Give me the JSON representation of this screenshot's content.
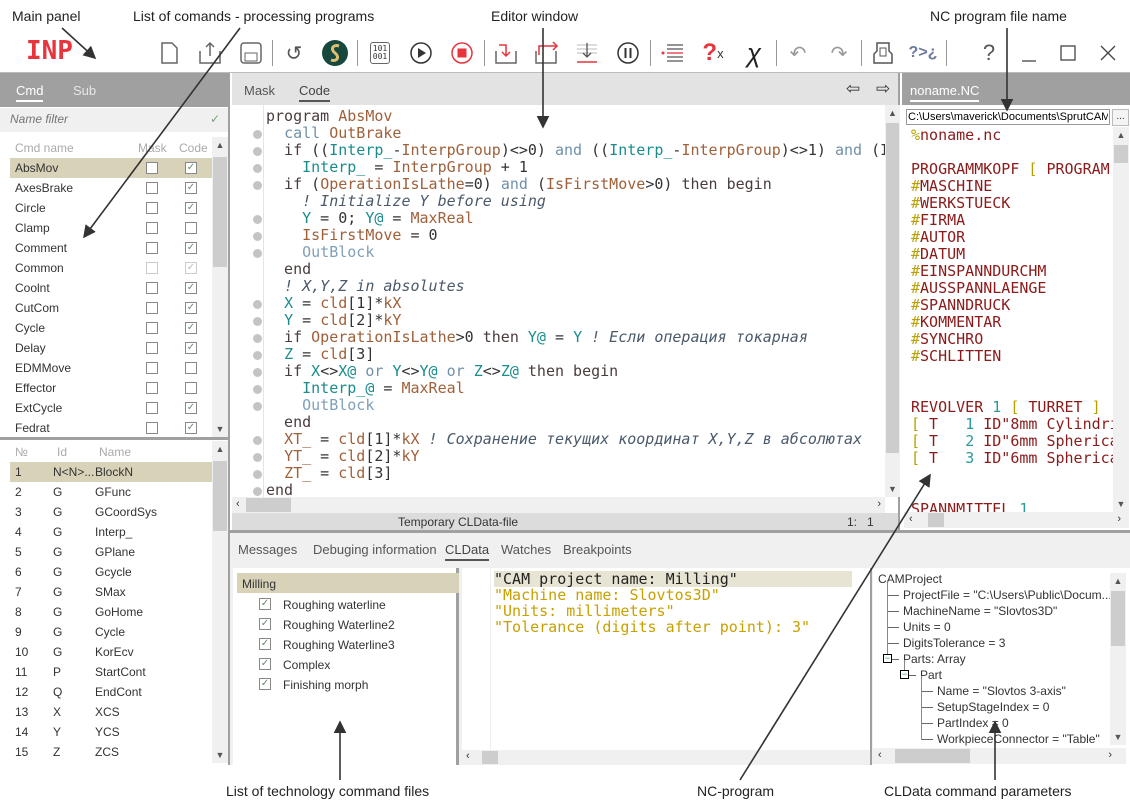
{
  "annotations": {
    "top": [
      "Main panel",
      "List of comands - processing programs",
      "Editor window",
      "NC program file name"
    ],
    "bottom": [
      "List of technology command files",
      "NC-program",
      "CLData command parameters"
    ]
  },
  "toolbar": {
    "logo": "INP",
    "binary_icon_text": "101\n001",
    "icons": [
      "new-file-icon",
      "export-icon",
      "save-icon",
      "reload-icon",
      "sprutcam-logo-icon",
      "compile-binary-icon",
      "run-icon",
      "stop-icon",
      "step-into-icon",
      "step-over-icon",
      "step-out-icon",
      "pause-icon",
      "breakpoint-list-icon",
      "clear-watch-icon",
      "cross-icon",
      "undo-icon",
      "redo-icon",
      "machine-icon",
      "translate-icon",
      "help-icon",
      "minimize-icon",
      "maximize-icon",
      "close-icon"
    ],
    "help_label": "?",
    "translate_label": "?>¿",
    "colors": {
      "logo": "#e8343c",
      "stop": "#e8343c"
    }
  },
  "left_panel": {
    "tabs": [
      "Cmd",
      "Sub"
    ],
    "active_tab": "Cmd",
    "filter_placeholder": "Name filter",
    "columns": [
      "Cmd name",
      "Mask",
      "Code"
    ],
    "commands": [
      {
        "name": "AbsMov",
        "mask": false,
        "code": true,
        "selected": true
      },
      {
        "name": "AxesBrake",
        "mask": false,
        "code": true
      },
      {
        "name": "Circle",
        "mask": false,
        "code": true
      },
      {
        "name": "Clamp",
        "mask": false,
        "code": false
      },
      {
        "name": "Comment",
        "mask": false,
        "code": true
      },
      {
        "name": "Common",
        "mask": false,
        "code": true,
        "disabled": true
      },
      {
        "name": "Coolnt",
        "mask": false,
        "code": true
      },
      {
        "name": "CutCom",
        "mask": false,
        "code": true
      },
      {
        "name": "Cycle",
        "mask": false,
        "code": true
      },
      {
        "name": "Delay",
        "mask": false,
        "code": true
      },
      {
        "name": "EDMMove",
        "mask": false,
        "code": false
      },
      {
        "name": "Effector",
        "mask": false,
        "code": false
      },
      {
        "name": "ExtCycle",
        "mask": false,
        "code": true
      },
      {
        "name": "Fedrat",
        "mask": false,
        "code": true
      }
    ],
    "reg_columns": [
      "№",
      "Id",
      "Name"
    ],
    "registers": [
      [
        "1",
        "N<N>...",
        "BlockN"
      ],
      [
        "2",
        "G",
        "GFunc"
      ],
      [
        "3",
        "G",
        "GCoordSys"
      ],
      [
        "4",
        "G",
        "Interp_"
      ],
      [
        "5",
        "G",
        "GPlane"
      ],
      [
        "6",
        "G",
        "Gcycle"
      ],
      [
        "7",
        "G",
        "SMax"
      ],
      [
        "8",
        "G",
        "GoHome"
      ],
      [
        "9",
        "G",
        "Cycle"
      ],
      [
        "10",
        "G",
        "KorEcv"
      ],
      [
        "11",
        "P",
        "StartCont"
      ],
      [
        "12",
        "Q",
        "EndCont"
      ],
      [
        "13",
        "X",
        "XCS"
      ],
      [
        "14",
        "Y",
        "YCS"
      ],
      [
        "15",
        "Z",
        "ZCS"
      ]
    ]
  },
  "editor": {
    "tabs": [
      "Mask",
      "Code"
    ],
    "active_tab": "Code",
    "status_label": "Temporary CLData-file",
    "cursor_pos": "1:   1",
    "lines": [
      {
        "dot": false,
        "tokens": [
          [
            "program ",
            "k"
          ],
          [
            "AbsMov",
            "f"
          ]
        ]
      },
      {
        "dot": true,
        "tokens": [
          [
            "  ",
            " p"
          ],
          [
            "call ",
            "l"
          ],
          [
            "OutBrake",
            "f"
          ]
        ]
      },
      {
        "dot": true,
        "tokens": [
          [
            "  if ",
            "k"
          ],
          [
            "((",
            "p"
          ],
          [
            "Interp_",
            "v"
          ],
          [
            "-",
            "p"
          ],
          [
            "InterpGroup",
            "f"
          ],
          [
            ")<>0) ",
            "p"
          ],
          [
            "and ",
            "l"
          ],
          [
            "((",
            "p"
          ],
          [
            "Interp_",
            "v"
          ],
          [
            "-",
            "p"
          ],
          [
            "InterpGroup",
            "f"
          ],
          [
            ")<>1) ",
            "p"
          ],
          [
            "and ",
            "l"
          ],
          [
            "(I",
            "p"
          ]
        ]
      },
      {
        "dot": true,
        "tokens": [
          [
            "    ",
            "p"
          ],
          [
            "Interp_",
            "v"
          ],
          [
            " = ",
            "p"
          ],
          [
            "InterpGroup",
            "f"
          ],
          [
            " + 1",
            "p"
          ]
        ]
      },
      {
        "dot": true,
        "tokens": [
          [
            "  if ",
            "k"
          ],
          [
            "(",
            "p"
          ],
          [
            "OperationIsLathe",
            "f"
          ],
          [
            "=0) ",
            "p"
          ],
          [
            "and ",
            "l"
          ],
          [
            "(",
            "p"
          ],
          [
            "IsFirstMove",
            "f"
          ],
          [
            ">0) ",
            "p"
          ],
          [
            "then begin",
            "k"
          ]
        ]
      },
      {
        "dot": false,
        "tokens": [
          [
            "    ! Initialize Y before using",
            "c"
          ]
        ]
      },
      {
        "dot": true,
        "tokens": [
          [
            "    ",
            "p"
          ],
          [
            "Y",
            "v"
          ],
          [
            " = 0; ",
            "p"
          ],
          [
            "Y@",
            "v"
          ],
          [
            " = ",
            "p"
          ],
          [
            "MaxReal",
            "f"
          ]
        ]
      },
      {
        "dot": true,
        "tokens": [
          [
            "    ",
            "p"
          ],
          [
            "IsFirstMove",
            "f"
          ],
          [
            " = 0",
            "p"
          ]
        ]
      },
      {
        "dot": true,
        "tokens": [
          [
            "    ",
            "p"
          ],
          [
            "OutBlock",
            "o"
          ]
        ]
      },
      {
        "dot": false,
        "tokens": [
          [
            "  end",
            "k"
          ]
        ]
      },
      {
        "dot": false,
        "tokens": [
          [
            "  ! X,Y,Z in absolutes",
            "c"
          ]
        ]
      },
      {
        "dot": true,
        "tokens": [
          [
            "  ",
            "p"
          ],
          [
            "X",
            "v"
          ],
          [
            " = ",
            "p"
          ],
          [
            "cld",
            "f"
          ],
          [
            "[1]*",
            "p"
          ],
          [
            "kX",
            "f"
          ]
        ]
      },
      {
        "dot": true,
        "tokens": [
          [
            "  ",
            "p"
          ],
          [
            "Y",
            "v"
          ],
          [
            " = ",
            "p"
          ],
          [
            "cld",
            "f"
          ],
          [
            "[2]*",
            "p"
          ],
          [
            "kY",
            "f"
          ]
        ]
      },
      {
        "dot": true,
        "tokens": [
          [
            "  if ",
            "k"
          ],
          [
            "OperationIsLathe",
            "f"
          ],
          [
            ">0 ",
            "p"
          ],
          [
            "then ",
            "k"
          ],
          [
            "Y@",
            "v"
          ],
          [
            " = ",
            "p"
          ],
          [
            "Y",
            "v"
          ],
          [
            " ! Если операция токарная",
            "c"
          ]
        ]
      },
      {
        "dot": true,
        "tokens": [
          [
            "  ",
            "p"
          ],
          [
            "Z",
            "v"
          ],
          [
            " = ",
            "p"
          ],
          [
            "cld",
            "f"
          ],
          [
            "[3]",
            "p"
          ]
        ]
      },
      {
        "dot": true,
        "tokens": [
          [
            "  if ",
            "k"
          ],
          [
            "X",
            "v"
          ],
          [
            "<>",
            "p"
          ],
          [
            "X@",
            "v"
          ],
          [
            " or ",
            "l"
          ],
          [
            "Y",
            "v"
          ],
          [
            "<>",
            "p"
          ],
          [
            "Y@",
            "v"
          ],
          [
            " or ",
            "l"
          ],
          [
            "Z",
            "v"
          ],
          [
            "<>",
            "p"
          ],
          [
            "Z@",
            "v"
          ],
          [
            " then begin",
            "k"
          ]
        ]
      },
      {
        "dot": true,
        "tokens": [
          [
            "    ",
            "p"
          ],
          [
            "Interp_@",
            "v"
          ],
          [
            " = ",
            "p"
          ],
          [
            "MaxReal",
            "f"
          ]
        ]
      },
      {
        "dot": true,
        "tokens": [
          [
            "    ",
            "p"
          ],
          [
            "OutBlock",
            "o"
          ]
        ]
      },
      {
        "dot": false,
        "tokens": [
          [
            "  end",
            "k"
          ]
        ]
      },
      {
        "dot": true,
        "tokens": [
          [
            "  ",
            "p"
          ],
          [
            "XT_",
            "f"
          ],
          [
            " = ",
            "p"
          ],
          [
            "cld",
            "f"
          ],
          [
            "[1]*",
            "p"
          ],
          [
            "kX",
            "f"
          ],
          [
            " ! Сохранение текущих координат X,Y,Z в абсолютах",
            "c"
          ]
        ]
      },
      {
        "dot": true,
        "tokens": [
          [
            "  ",
            "p"
          ],
          [
            "YT_",
            "f"
          ],
          [
            " = ",
            "p"
          ],
          [
            "cld",
            "f"
          ],
          [
            "[2]*",
            "p"
          ],
          [
            "kY",
            "f"
          ]
        ]
      },
      {
        "dot": true,
        "tokens": [
          [
            "  ",
            "p"
          ],
          [
            "ZT_",
            "f"
          ],
          [
            " = ",
            "p"
          ],
          [
            "cld",
            "f"
          ],
          [
            "[3]",
            "p"
          ]
        ]
      },
      {
        "dot": true,
        "tokens": [
          [
            "end",
            "k"
          ]
        ]
      }
    ]
  },
  "nc_panel": {
    "tab": "noname.NC",
    "file_path": "C:\\Users\\maverick\\Documents\\SprutCAM",
    "browse_label": "...",
    "lines": [
      [
        [
          "%",
          "ny"
        ],
        [
          "noname.nc",
          "nr"
        ]
      ],
      [],
      [
        [
          "PROGRAMMKOPF ",
          "nr"
        ],
        [
          "[",
          "ny"
        ],
        [
          " PROGRAM",
          "nr"
        ]
      ],
      [
        [
          "#",
          "ny"
        ],
        [
          "MASCHINE",
          "nr"
        ]
      ],
      [
        [
          "#",
          "ny"
        ],
        [
          "WERKSTUECK",
          "nr"
        ]
      ],
      [
        [
          "#",
          "ny"
        ],
        [
          "FIRMA",
          "nr"
        ]
      ],
      [
        [
          "#",
          "ny"
        ],
        [
          "AUTOR",
          "nr"
        ]
      ],
      [
        [
          "#",
          "ny"
        ],
        [
          "DATUM",
          "nr"
        ]
      ],
      [
        [
          "#",
          "ny"
        ],
        [
          "EINSPANNDURCHM",
          "nr"
        ]
      ],
      [
        [
          "#",
          "ny"
        ],
        [
          "AUSSPANNLAENGE",
          "nr"
        ]
      ],
      [
        [
          "#",
          "ny"
        ],
        [
          "SPANNDRUCK",
          "nr"
        ]
      ],
      [
        [
          "#",
          "ny"
        ],
        [
          "KOMMENTAR",
          "nr"
        ]
      ],
      [
        [
          "#",
          "ny"
        ],
        [
          "SYNCHRO",
          "nr"
        ]
      ],
      [
        [
          "#",
          "ny"
        ],
        [
          "SCHLITTEN",
          "nr"
        ]
      ],
      [],
      [],
      [
        [
          "REVOLVER ",
          "nr"
        ],
        [
          "1",
          "nt"
        ],
        [
          " [",
          "ny"
        ],
        [
          " TURRET ",
          "nr"
        ],
        [
          "]",
          "ny"
        ]
      ],
      [
        [
          "[",
          "ny"
        ],
        [
          " T   ",
          "nr"
        ],
        [
          "1",
          "nt"
        ],
        [
          " ID\"8mm Cylindri",
          "nr"
        ]
      ],
      [
        [
          "[",
          "ny"
        ],
        [
          " T   ",
          "nr"
        ],
        [
          "2",
          "nt"
        ],
        [
          " ID\"6mm Spherica",
          "nr"
        ]
      ],
      [
        [
          "[",
          "ny"
        ],
        [
          " T   ",
          "nr"
        ],
        [
          "3",
          "nt"
        ],
        [
          " ID\"6mm Spherica",
          "nr"
        ]
      ],
      [],
      [],
      [
        [
          "SPANNMITTEL ",
          "nr"
        ],
        [
          "1",
          "nt"
        ]
      ]
    ]
  },
  "bottom_panel": {
    "tabs": [
      "Messages",
      "Debuging information",
      "CLData",
      "Watches",
      "Breakpoints"
    ],
    "active_tab": "CLData",
    "operation_group": "Milling",
    "operations": [
      {
        "name": "Roughing waterline",
        "checked": true
      },
      {
        "name": "Roughing Waterline2",
        "checked": true
      },
      {
        "name": "Roughing Waterline3",
        "checked": true
      },
      {
        "name": "Complex",
        "checked": true
      },
      {
        "name": "Finishing morph",
        "checked": true
      }
    ],
    "cldata_lines": [
      "\"CAM project name: Milling\"",
      "\"Machine name: Slovtos3D\"",
      "\"Units: millimeters\"",
      "\"Tolerance (digits after point): 3\""
    ],
    "tree": [
      {
        "level": 0,
        "text": "CAMProject"
      },
      {
        "level": 1,
        "text": "ProjectFile = \"C:\\Users\\Public\\Docum..."
      },
      {
        "level": 1,
        "text": "MachineName = \"Slovtos3D\""
      },
      {
        "level": 1,
        "text": "Units = 0"
      },
      {
        "level": 1,
        "text": "DigitsTolerance = 3"
      },
      {
        "level": 1,
        "text": "Parts: Array",
        "expander": "−"
      },
      {
        "level": 2,
        "text": "Part",
        "expander": "−"
      },
      {
        "level": 3,
        "text": "Name = \"Slovtos 3-axis\""
      },
      {
        "level": 3,
        "text": "SetupStageIndex = 0"
      },
      {
        "level": 3,
        "text": "PartIndex = 0"
      },
      {
        "level": 3,
        "text": "WorkpieceConnector = \"Table\""
      }
    ]
  }
}
